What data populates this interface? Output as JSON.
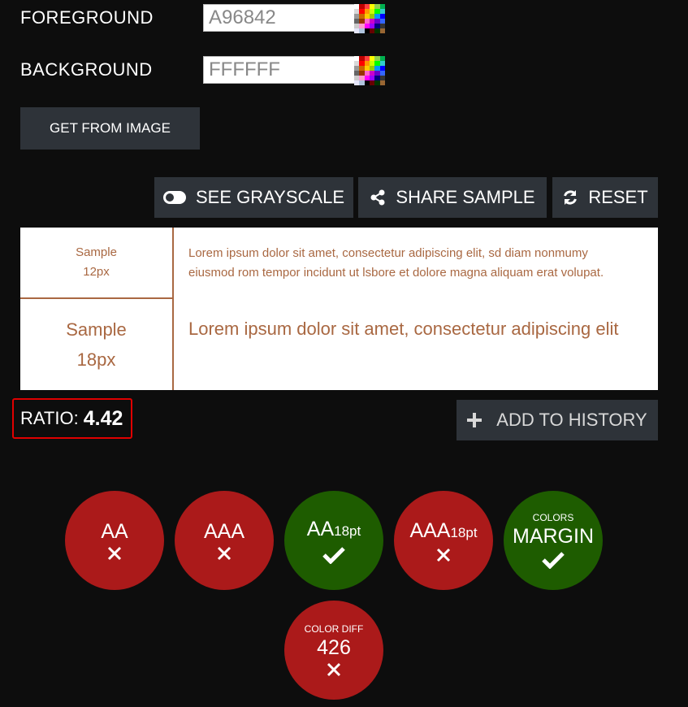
{
  "foreground": {
    "label": "FOREGROUND",
    "value": "A96842"
  },
  "background": {
    "label": "BACKGROUND",
    "value": "FFFFFF"
  },
  "get_from_image": "GET FROM IMAGE",
  "toolbar": {
    "grayscale": "SEE GRAYSCALE",
    "share": "SHARE SAMPLE",
    "reset": "RESET"
  },
  "samples": {
    "small": {
      "label": "Sample",
      "size": "12px",
      "text": "Lorem ipsum dolor sit amet, consectetur adipiscing elit, sd diam nonmumy eiusmod rom tempor incidunt ut lsbore et dolore magna aliquam erat volupat."
    },
    "large": {
      "label": "Sample",
      "size": "18px",
      "text": "Lorem ipsum dolor sit amet, consectetur adipiscing elit"
    }
  },
  "ratio": {
    "label": "RATIO:",
    "value": "4.42"
  },
  "add_history": "ADD TO HISTORY",
  "badges": {
    "aa": {
      "text": "AA",
      "status": "fail"
    },
    "aaa": {
      "text": "AAA",
      "status": "fail"
    },
    "aa18": {
      "text": "AA",
      "sub": "18pt",
      "status": "pass"
    },
    "aaa18": {
      "text": "AAA",
      "sub": "18pt",
      "status": "fail"
    },
    "margin": {
      "top": "COLORS",
      "text": "MARGIN",
      "status": "pass"
    },
    "colordiff": {
      "top": "COLOR DIFF",
      "text": "426",
      "status": "fail"
    }
  },
  "colors": {
    "foreground": "#a96842",
    "fail": "#ab1a1a",
    "pass": "#1e5c00",
    "button_bg": "#2e3339",
    "highlight": "#e00000"
  },
  "icons": {
    "palette": "palette-icon",
    "toggle": "toggle-icon",
    "share": "share-icon",
    "refresh": "refresh-icon",
    "plus": "plus-icon",
    "check": "check-icon",
    "cross": "cross-icon"
  }
}
